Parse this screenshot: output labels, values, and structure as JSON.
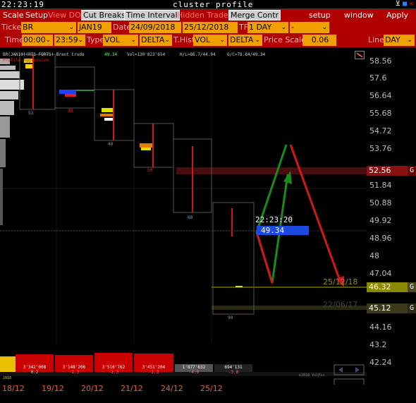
{
  "titlebar": {
    "clock": "22:23:19",
    "title": "cluster profile"
  },
  "menu": {
    "scale": "Scale",
    "setup": "Setup",
    "view_dom": "View DOM",
    "cut_breaks": "Cut Breaks",
    "time_interval": "Time Interval",
    "hidden_trades": "Hidden Trades",
    "merge_contr": "Merge Contr",
    "setup_right": "setup",
    "window": "window",
    "apply": "Apply"
  },
  "row1": {
    "ticker_label": "Ticker",
    "ticker": "BR",
    "contract": "JAN19",
    "date_label": "Date",
    "date_from": "24/09/2018",
    "date_to": "25/12/2018",
    "tf_label": "TF",
    "tf": "1 DAY",
    "tf_extra": "-"
  },
  "row2": {
    "time_label": "Time",
    "time_from": "00:00",
    "time_to": "23:59",
    "type_label": "Type",
    "type": "VOL",
    "type_mode": "DELTA",
    "thist_label": "T.Hist",
    "thist": "VOL",
    "thist_mode": "DELTA",
    "price_scale_label": "Price Scale",
    "price_scale": "0.06",
    "line_label": "Line",
    "line": "DAY"
  },
  "chart": {
    "info_name": "BR(JAN19)(RTS FORTS) Brent Crude",
    "info_last": "49.34",
    "info_vol": "Vol=130'823'654",
    "info_hl": "H/L=86.7/44.94",
    "info_oc": "O/C=78.84/49.34",
    "info_sub": "Profile  Aggressive",
    "crosshair_time": "22:23:20",
    "crosshair_price": "49.34",
    "level1_label": "25/12/18",
    "level2_label": "22/06/17",
    "copyright": "©2018 VolFix",
    "cluster_numbers": [
      "53",
      "35",
      "40",
      "50",
      "60",
      "90"
    ]
  },
  "price_axis": {
    "ticks": [
      "58.56",
      "57.6",
      "56.64",
      "55.68",
      "54.72",
      "53.76",
      "52.56",
      "51.84",
      "50.88",
      "49.92",
      "48.96",
      "48",
      "47.04",
      "46.32",
      "45.12",
      "44.16",
      "43.2",
      "42.24"
    ],
    "tag_red": "52.56",
    "tag_olive": "46.32",
    "tag_dark": "45.12",
    "g": "G"
  },
  "volume_bars": [
    {
      "value": "3'342'008",
      "delta": "0.2"
    },
    {
      "value": "3'148'206",
      "delta": "-1.3"
    },
    {
      "value": "3'510'762",
      "delta": "-1.3"
    },
    {
      "value": "3'451'204",
      "delta": "-1.3"
    },
    {
      "value": "1'877'632",
      "delta": "-4.8"
    },
    {
      "value": "694'131",
      "delta": "-3.8"
    }
  ],
  "year": "2018",
  "x_labels": [
    "18/12",
    "19/12",
    "20/12",
    "21/12",
    "24/12",
    "25/12"
  ],
  "colors": {
    "menu": "#b00000",
    "field": "#f0a000",
    "up": "#1a8a1a",
    "down": "#d01818",
    "tag_red": "#8a1010",
    "tag_olive": "#8a8a00"
  }
}
